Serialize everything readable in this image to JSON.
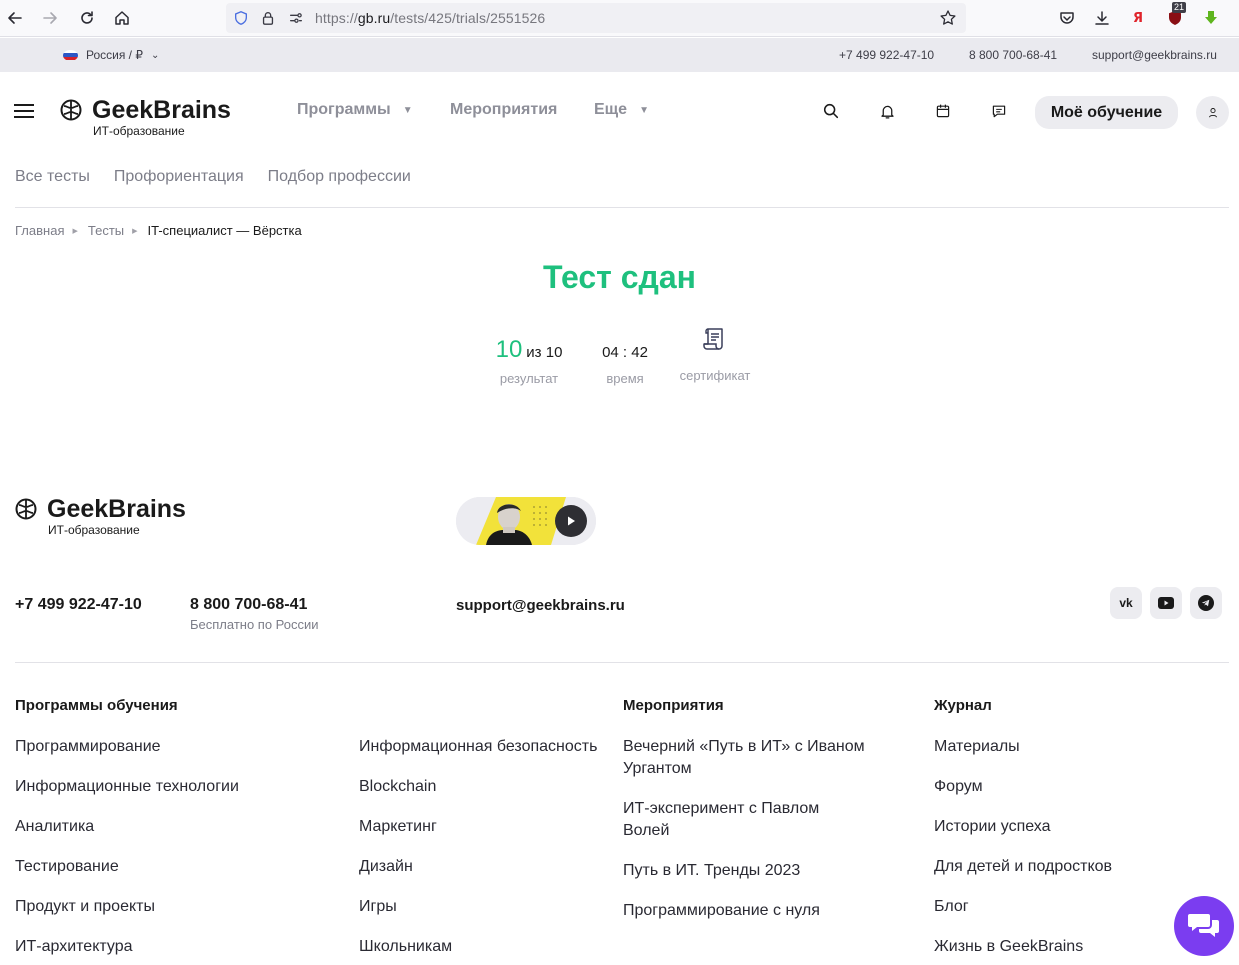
{
  "browser": {
    "url_prefix": "https://",
    "url_host": "gb.ru",
    "url_path": "/tests/425/trials/2551526",
    "ext_badge": "21"
  },
  "infobar": {
    "region": "Россия / ₽",
    "phone1": "+7 499 922-47-10",
    "phone2": "8 800 700-68-41",
    "email": "support@geekbrains.ru"
  },
  "header": {
    "brand": "GeekBrains",
    "brand_sub": "ИТ-образование",
    "nav": [
      "Программы",
      "Мероприятия",
      "Еще"
    ],
    "my_learning": "Моё обучение"
  },
  "subnav": [
    "Все тесты",
    "Профориентация",
    "Подбор профессии"
  ],
  "breadcrumb": [
    "Главная",
    "Тесты",
    "IT-специалист — Вёрстка"
  ],
  "result": {
    "title": "Тест сдан",
    "score": "10",
    "score_total": "из 10",
    "score_label": "результат",
    "time": "04 : 42",
    "time_label": "время",
    "cert_label": "сертификат"
  },
  "footer": {
    "brand": "GeekBrains",
    "brand_sub": "ИТ-образование",
    "phone1": "+7 499 922-47-10",
    "phone2": "8 800 700-68-41",
    "phone2_note": "Бесплатно по России",
    "email": "support@geekbrains.ru",
    "columns": {
      "programs": {
        "title": "Программы обучения",
        "left": [
          "Программирование",
          "Информационные технологии",
          "Аналитика",
          "Тестирование",
          "Продукт и проекты",
          "ИТ-архитектура"
        ],
        "right": [
          "Информационная безопасность",
          "Blockchain",
          "Маркетинг",
          "Дизайн",
          "Игры",
          "Школьникам"
        ]
      },
      "events": {
        "title": "Мероприятия",
        "items": [
          "Вечерний «Путь в ИТ» с Иваном Ургантом",
          "ИТ-эксперимент с Павлом Волей",
          "Путь в ИТ. Тренды 2023",
          "Программирование с нуля"
        ]
      },
      "journal": {
        "title": "Журнал",
        "items": [
          "Материалы",
          "Форум",
          "Истории успеха",
          "Для детей и подростков",
          "Блог",
          "Жизнь в GeekBrains"
        ]
      }
    }
  },
  "colors": {
    "accent_green": "#1ec07e",
    "chat_purple": "#7b3df0"
  }
}
